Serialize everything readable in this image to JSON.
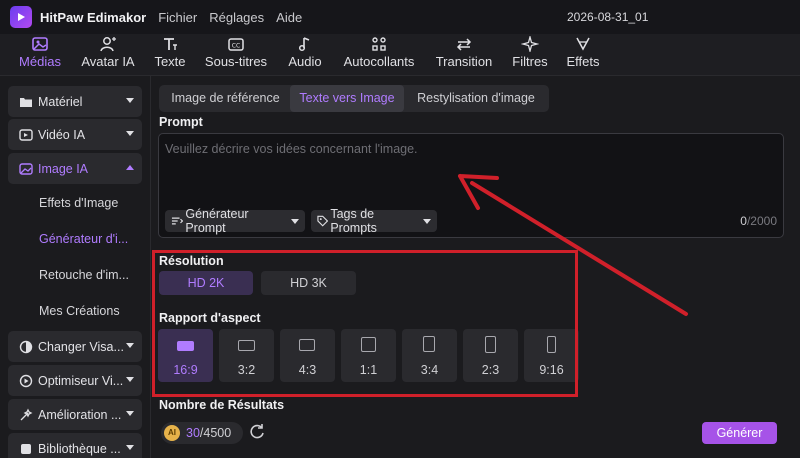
{
  "app": {
    "title": "HitPaw Edimakor",
    "project": "2026-08-31_01"
  },
  "menu": [
    "Fichier",
    "Réglages",
    "Aide"
  ],
  "toolbar": [
    {
      "label": "Médias",
      "icon": "media-icon",
      "active": true
    },
    {
      "label": "Avatar IA",
      "icon": "avatar-icon",
      "active": false
    },
    {
      "label": "Texte",
      "icon": "text-icon",
      "active": false
    },
    {
      "label": "Sous-titres",
      "icon": "subtitles-icon",
      "active": false
    },
    {
      "label": "Audio",
      "icon": "music-note-icon",
      "active": false
    },
    {
      "label": "Autocollants",
      "icon": "stickers-icon",
      "active": false
    },
    {
      "label": "Transition",
      "icon": "transition-icon",
      "active": false
    },
    {
      "label": "Filtres",
      "icon": "sparkle-icon",
      "active": false
    },
    {
      "label": "Effets",
      "icon": "effects-icon",
      "active": false
    }
  ],
  "sidebar": {
    "items": [
      {
        "label": "Matériel",
        "icon": "folder-icon"
      },
      {
        "label": "Vidéo IA",
        "icon": "video-ai-icon"
      },
      {
        "label": "Image IA",
        "icon": "image-ai-icon",
        "expanded": true
      },
      {
        "label": "Changer Visa...",
        "icon": "face-swap-icon"
      },
      {
        "label": "Optimiseur Vi...",
        "icon": "optimizer-icon"
      },
      {
        "label": "Amélioration ...",
        "icon": "enhance-icon"
      },
      {
        "label": "Bibliothèque ...",
        "icon": "library-icon"
      }
    ],
    "subitems": [
      "Effets d'Image",
      "Générateur d'i...",
      "Retouche d'im...",
      "Mes Créations"
    ]
  },
  "tabs": [
    "Image de référence",
    "Texte vers Image",
    "Restylisation d'image"
  ],
  "prompt": {
    "label": "Prompt",
    "placeholder": "Veuillez décrire vos idées concernant l'image.",
    "generator_chip": "Générateur Prompt",
    "tags_chip": "Tags de Prompts",
    "count": "0",
    "max": "/2000"
  },
  "resolution": {
    "label": "Résolution",
    "options": [
      "HD 2K",
      "HD 3K"
    ],
    "selected": "HD 2K"
  },
  "aspect": {
    "label": "Rapport d'aspect",
    "options": [
      "16:9",
      "3:2",
      "4:3",
      "1:1",
      "3:4",
      "2:3",
      "9:16"
    ],
    "selected": "16:9"
  },
  "results_label": "Nombre de Résultats",
  "credits": {
    "coin": "AI",
    "used": "30",
    "total": "/4500"
  },
  "generate_label": "Générer",
  "colors": {
    "accent": "#b07cff",
    "button": "#a653e8",
    "annotation": "#d0202a"
  }
}
